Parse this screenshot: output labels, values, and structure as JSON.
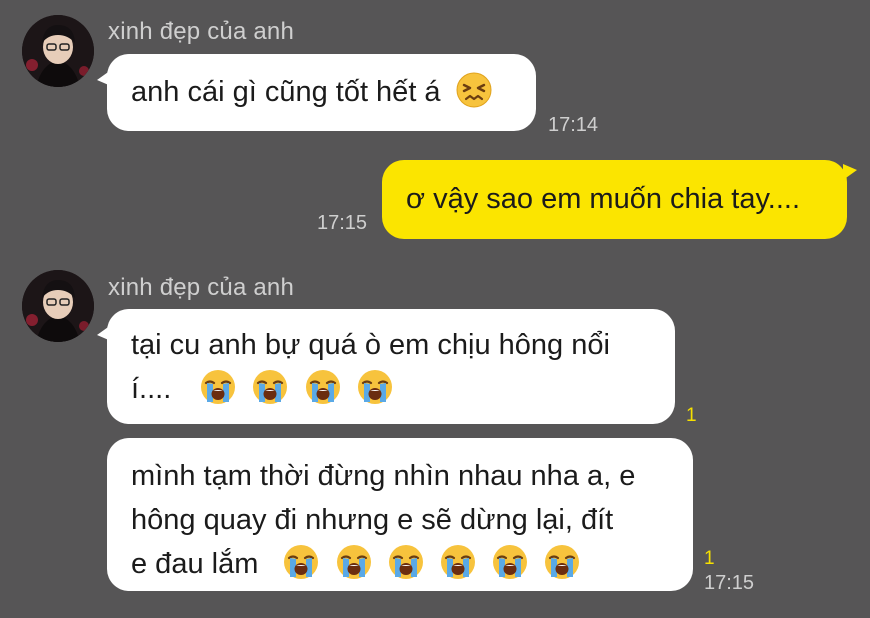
{
  "messages": [
    {
      "sender": "xinh đẹp của anh",
      "text": "anh cái gì cũng tốt hết á",
      "emojis": [
        "confounded-face"
      ],
      "time": "17:14"
    },
    {
      "text": "ơ vậy sao em muốn chia tay....",
      "time": "17:15"
    },
    {
      "sender": "xinh đẹp của anh",
      "text_line1": "tại cu anh bự quá ò em chịu hông nổi",
      "text_line2": "í....",
      "emojis": [
        "loudly-crying-face",
        "loudly-crying-face",
        "loudly-crying-face",
        "loudly-crying-face"
      ],
      "unread": "1"
    },
    {
      "text_line1": "mình tạm thời đừng nhìn nhau nha a, e",
      "text_line2": "hông quay đi nhưng e sẽ dừng lại, đít",
      "text_line3": "e đau lắm",
      "emojis": [
        "loudly-crying-face",
        "loudly-crying-face",
        "loudly-crying-face",
        "loudly-crying-face",
        "loudly-crying-face",
        "loudly-crying-face"
      ],
      "unread": "1",
      "time": "17:15"
    }
  ],
  "colors": {
    "background": "#565556",
    "my_bubble": "#fbe500",
    "their_bubble": "#ffffff",
    "unread": "#f6e000"
  }
}
